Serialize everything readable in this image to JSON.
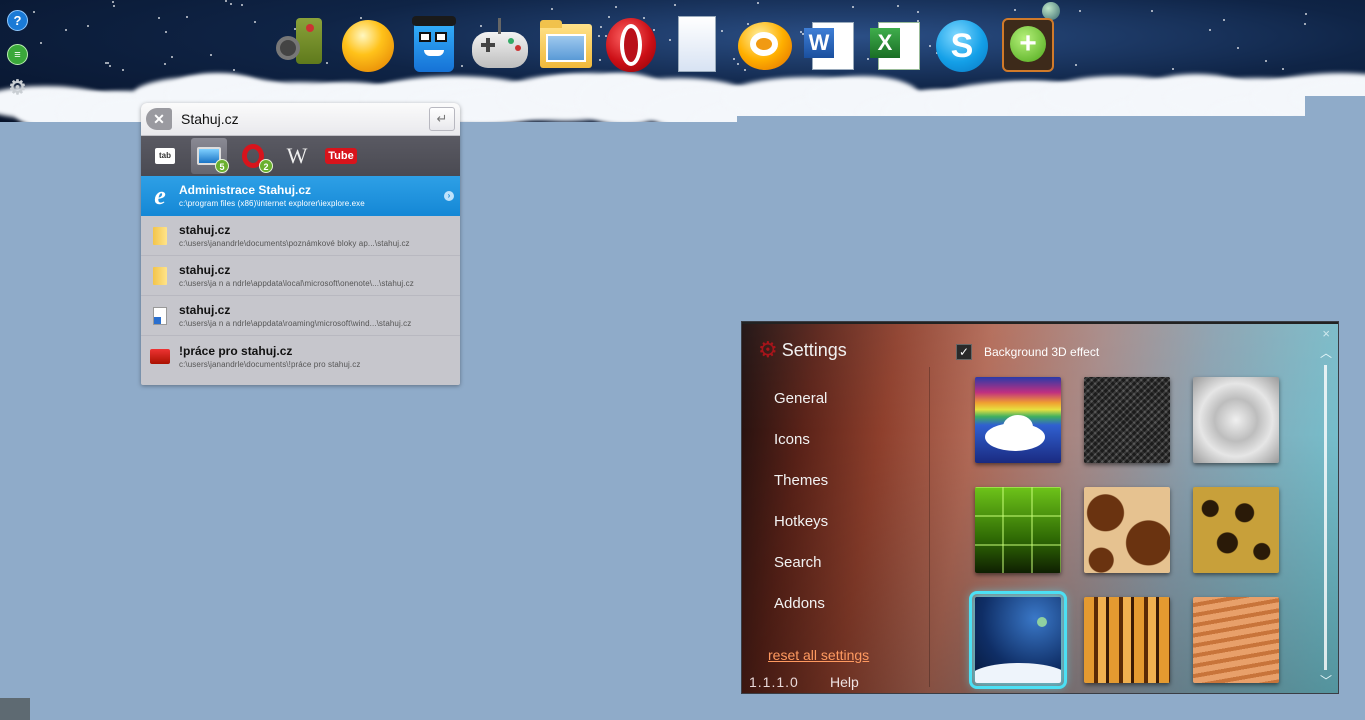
{
  "dock": {
    "icons": [
      {
        "name": "media-player-icon"
      },
      {
        "name": "orange-orb-icon"
      },
      {
        "name": "robot-character-icon"
      },
      {
        "name": "gamepad-icon"
      },
      {
        "name": "folder-icon"
      },
      {
        "name": "opera-icon"
      },
      {
        "name": "blank-document-icon"
      },
      {
        "name": "gom-player-icon"
      },
      {
        "name": "word-icon",
        "label": "W"
      },
      {
        "name": "excel-icon",
        "label": "X"
      },
      {
        "name": "skype-icon",
        "label": "S"
      },
      {
        "name": "add-icon",
        "label": "+"
      }
    ],
    "side_buttons": [
      {
        "name": "help-icon",
        "label": "?",
        "color": "#1a7ad6"
      },
      {
        "name": "chat-icon",
        "label": "≡",
        "color": "#3aa83a"
      },
      {
        "name": "gear-icon",
        "label": "⚙",
        "color": "#bfc4c9"
      }
    ]
  },
  "launcher": {
    "query": "Stahuj.cz",
    "clear_label": "✕",
    "enter_label": "↵",
    "tabs": [
      {
        "name": "tab-key",
        "label": "tab"
      },
      {
        "name": "tab-computer",
        "badge": "5"
      },
      {
        "name": "tab-opera",
        "badge": "2"
      },
      {
        "name": "tab-wikipedia",
        "label": "W"
      },
      {
        "name": "tab-youtube",
        "label": "Tube"
      }
    ],
    "results": [
      {
        "title": "Administrace Stahuj.cz",
        "path": "c:\\program  files  (x86)\\internet  explorer\\iexplore.exe",
        "icon": "internet-explorer-icon",
        "selected": true
      },
      {
        "title": "stahuj.cz",
        "path": "c:\\users\\janandrle\\documents\\poznámkové   bloky   ap...\\stahuj.cz",
        "icon": "folder-icon"
      },
      {
        "title": "stahuj.cz",
        "path": "c:\\users\\ja n a ndrle\\appdata\\local\\microsoft\\onenote\\...\\stahuj.cz",
        "icon": "folder-icon"
      },
      {
        "title": "stahuj.cz",
        "path": "c:\\users\\ja n a ndrle\\appdata\\roaming\\microsoft\\wind...\\stahuj.cz",
        "icon": "shortcut-icon"
      },
      {
        "title": "!práce pro stahuj.cz",
        "path": "c:\\users\\janandrle\\documents\\!práce  pro  stahuj.cz",
        "icon": "red-folder-icon"
      }
    ]
  },
  "settings": {
    "title": "Settings",
    "close_label": "×",
    "nav": [
      "General",
      "Icons",
      "Themes",
      "Hotkeys",
      "Search",
      "Addons"
    ],
    "reset_label": "reset all settings",
    "version": "1.1.1.0",
    "help_label": "Help",
    "bg3d_label": "Background 3D effect",
    "bg3d_checked": "✓",
    "scroll_up": "︿",
    "scroll_down": "﹀",
    "themes": [
      {
        "name": "theme-rainbow-clouds"
      },
      {
        "name": "theme-carbon-mesh"
      },
      {
        "name": "theme-brushed-metal"
      },
      {
        "name": "theme-green-grid"
      },
      {
        "name": "theme-giraffe-fur"
      },
      {
        "name": "theme-leopard-fur"
      },
      {
        "name": "theme-space-clouds",
        "selected": true
      },
      {
        "name": "theme-tiger-fur"
      },
      {
        "name": "theme-sand-dunes"
      }
    ],
    "accent": "#4ce0f4",
    "link_color": "#ff9a60"
  }
}
